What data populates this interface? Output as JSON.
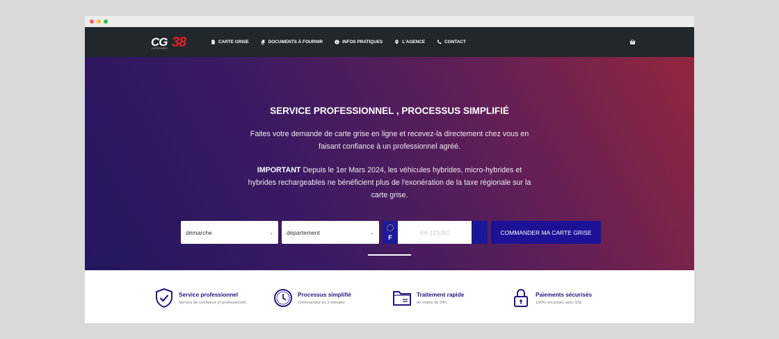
{
  "brand": {
    "logo_text": "CG38",
    "logo_subtext": "CARTEGRISE38"
  },
  "nav": {
    "items": [
      {
        "label": "CARTE GRISE",
        "icon": "document-icon"
      },
      {
        "label": "DOCUMENTS À FOURNIR",
        "icon": "files-icon"
      },
      {
        "label": "INFOS PRATIQUES",
        "icon": "info-icon"
      },
      {
        "label": "L'AGENCE",
        "icon": "map-pin-icon"
      },
      {
        "label": "CONTACT",
        "icon": "phone-icon"
      }
    ],
    "cart_icon": "shopping-basket-icon"
  },
  "hero": {
    "title": "SERVICE PROFESSIONNEL , PROCESSUS SIMPLIFIÉ",
    "paragraph1": "Faites votre demande de carte grise en ligne et recevez-la directement chez vous en faisant confiance à un professionnel agréé.",
    "important_label": "IMPORTANT",
    "paragraph2": " Depuis le 1er Mars 2024, les véhicules hybrides, micro-hybrides et hybrides rechargeables ne bénéficient plus de l'exonération de la taxe régionale sur la carte grise."
  },
  "form": {
    "select_demarche": "démarche",
    "select_departement": "département",
    "plate_country": "F",
    "plate_placeholder": "AA-123-BC",
    "submit_label": "COMMANDER MA CARTE GRISE"
  },
  "features": [
    {
      "title": "Service professionnel",
      "subtitle": "Service de confiance et professionnel",
      "icon": "shield-check-icon"
    },
    {
      "title": "Processus simplifié",
      "subtitle": "Commandez en 2 minutes",
      "icon": "clock-icon"
    },
    {
      "title": "Traitement rapide",
      "subtitle": "en moins de 24h",
      "icon": "folder-icon"
    },
    {
      "title": "Paiements sécurisés",
      "subtitle": "100% sécurisés avec SSL",
      "icon": "lock-icon"
    }
  ],
  "colors": {
    "navbar": "#22272b",
    "accent_blue": "#1d1296",
    "feature_title": "#24177f",
    "logo_red": "#e31e24"
  }
}
